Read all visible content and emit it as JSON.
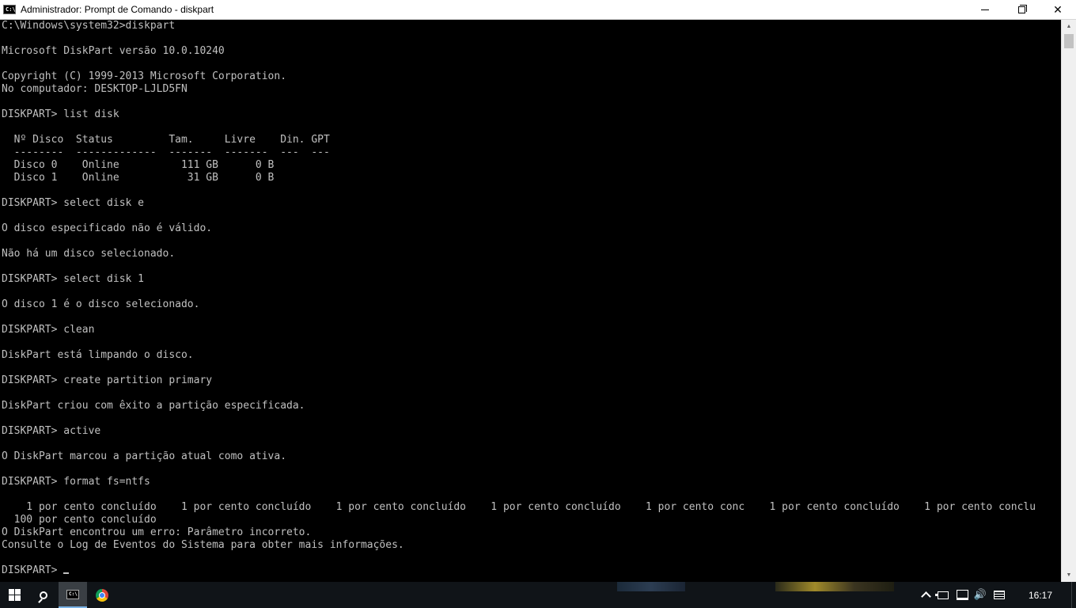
{
  "window": {
    "title": "Administrador: Prompt de Comando - diskpart",
    "icon": "cmd-icon",
    "icon_glyph": "C:\\",
    "buttons": [
      "minimize",
      "maximize",
      "close"
    ],
    "close_glyph": "✕"
  },
  "console": {
    "text_color": "#c0c0c0",
    "background": "#000000",
    "lines": [
      "C:\\Windows\\system32>diskpart",
      "",
      "Microsoft DiskPart versão 10.0.10240",
      "",
      "Copyright (C) 1999-2013 Microsoft Corporation.",
      "No computador: DESKTOP-LJLD5FN",
      "",
      "DISKPART> list disk",
      "",
      "  Nº Disco  Status         Tam.     Livre    Din. GPT",
      "  --------  -------------  -------  -------  ---  ---",
      "  Disco 0    Online          111 GB      0 B",
      "  Disco 1    Online           31 GB      0 B",
      "",
      "DISKPART> select disk e",
      "",
      "O disco especificado não é válido.",
      "",
      "Não há um disco selecionado.",
      "",
      "DISKPART> select disk 1",
      "",
      "O disco 1 é o disco selecionado.",
      "",
      "DISKPART> clean",
      "",
      "DiskPart está limpando o disco.",
      "",
      "DISKPART> create partition primary",
      "",
      "DiskPart criou com êxito a partição especificada.",
      "",
      "DISKPART> active",
      "",
      "O DiskPart marcou a partição atual como ativa.",
      "",
      "DISKPART> format fs=ntfs",
      "",
      "    1 por cento concluído    1 por cento concluído    1 por cento concluído    1 por cento concluído    1 por cento conc    1 por cento concluído    1 por cento conclu",
      "  100 por cento concluído",
      "O DiskPart encontrou um erro: Parâmetro incorreto.",
      "Consulte o Log de Eventos do Sistema para obter mais informações.",
      ""
    ],
    "prompt": "DISKPART> "
  },
  "scrollbar": {
    "up_glyph": "▲",
    "down_glyph": "▼",
    "position": 0.0
  },
  "taskbar": {
    "items": [
      {
        "name": "start-button",
        "icon": "windows-logo-icon"
      },
      {
        "name": "search-button",
        "icon": "search-icon"
      },
      {
        "name": "cmd-taskbar-button",
        "icon": "cmd-icon",
        "active": true
      },
      {
        "name": "chrome-taskbar-button",
        "icon": "chrome-icon"
      }
    ],
    "tray": {
      "icons": [
        "chevron-up-icon",
        "power-icon",
        "network-icon",
        "volume-icon",
        "notifications-icon"
      ],
      "volume_glyph": "🔊",
      "clock": "16:17"
    },
    "accent": "#7ab3e6",
    "background": "#101418"
  }
}
